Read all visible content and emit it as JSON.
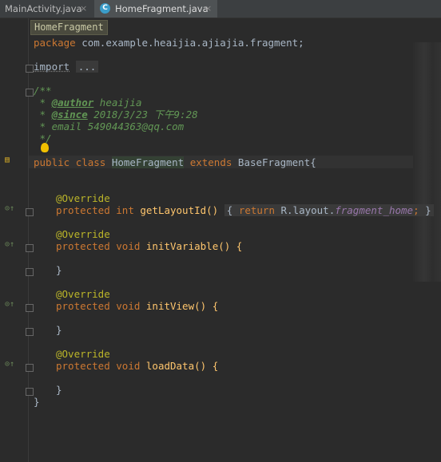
{
  "tabs": [
    {
      "label": "MainActivity.java",
      "close": "×"
    },
    {
      "label": "HomeFragment.java",
      "close": "×",
      "icon_letter": "C"
    }
  ],
  "breadcrumb": "HomeFragment",
  "code": {
    "package_kw": "package",
    "package_name": "com.example.heaijia.ajiajia.fragment;",
    "import_kw": "import",
    "import_fold": "...",
    "doc_open": "/**",
    "author_tag": "@author",
    "author_val": "heaijia",
    "since_tag": "@since",
    "since_val": "2018/3/23 下午9:28",
    "email_line": "email 549044363@qq.com",
    "doc_close": "*/",
    "class_public": "public",
    "class_kw": "class",
    "class_name": "HomeFragment",
    "extends_kw": "extends",
    "base_class": "BaseFragment{",
    "override": "@Override",
    "protected_kw": "protected",
    "int_kw": "int",
    "void_kw": "void",
    "m1_name": "getLayoutId()",
    "m1_body_open": "{",
    "m1_return": "return",
    "m1_r": "R.layout.",
    "m1_field": "fragment_home",
    "m1_end": ";",
    "m1_close": "}",
    "m2_name": "initVariable() {",
    "m3_name": "initView() {",
    "m4_name": "loadData() {",
    "brace_close": "}",
    "class_close": "}"
  },
  "colors": {
    "background": "#2b2b2b",
    "keyword": "#cc7832",
    "annotation": "#bbb529",
    "comment": "#629755",
    "text": "#a9b7c6"
  }
}
